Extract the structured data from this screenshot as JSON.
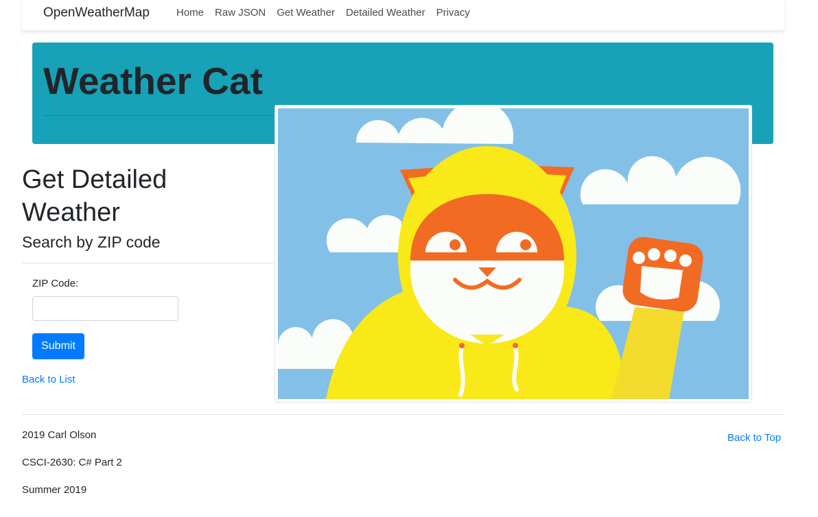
{
  "navbar": {
    "brand": "OpenWeatherMap",
    "links": [
      "Home",
      "Raw JSON",
      "Get Weather",
      "Detailed Weather",
      "Privacy"
    ]
  },
  "jumbotron": {
    "title": "Weather Cat"
  },
  "main": {
    "title": "Get Detailed Weather",
    "subtitle": "Search by ZIP code",
    "form": {
      "zip_label": "ZIP Code:",
      "zip_value": "",
      "submit_label": "Submit"
    },
    "back_link": "Back to List"
  },
  "footer": {
    "lines": [
      "2019 Carl Olson",
      "CSCI-2630: C# Part 2",
      "Summer 2019"
    ],
    "back_to_top": "Back to Top"
  },
  "colors": {
    "jumbotron_bg": "#17a2b8",
    "primary": "#007bff",
    "sky": "#82c0e8",
    "hoodie": "#fae918",
    "cat_orange": "#f26b22"
  },
  "icons": {
    "illustration": "weather-cat-illustration"
  }
}
